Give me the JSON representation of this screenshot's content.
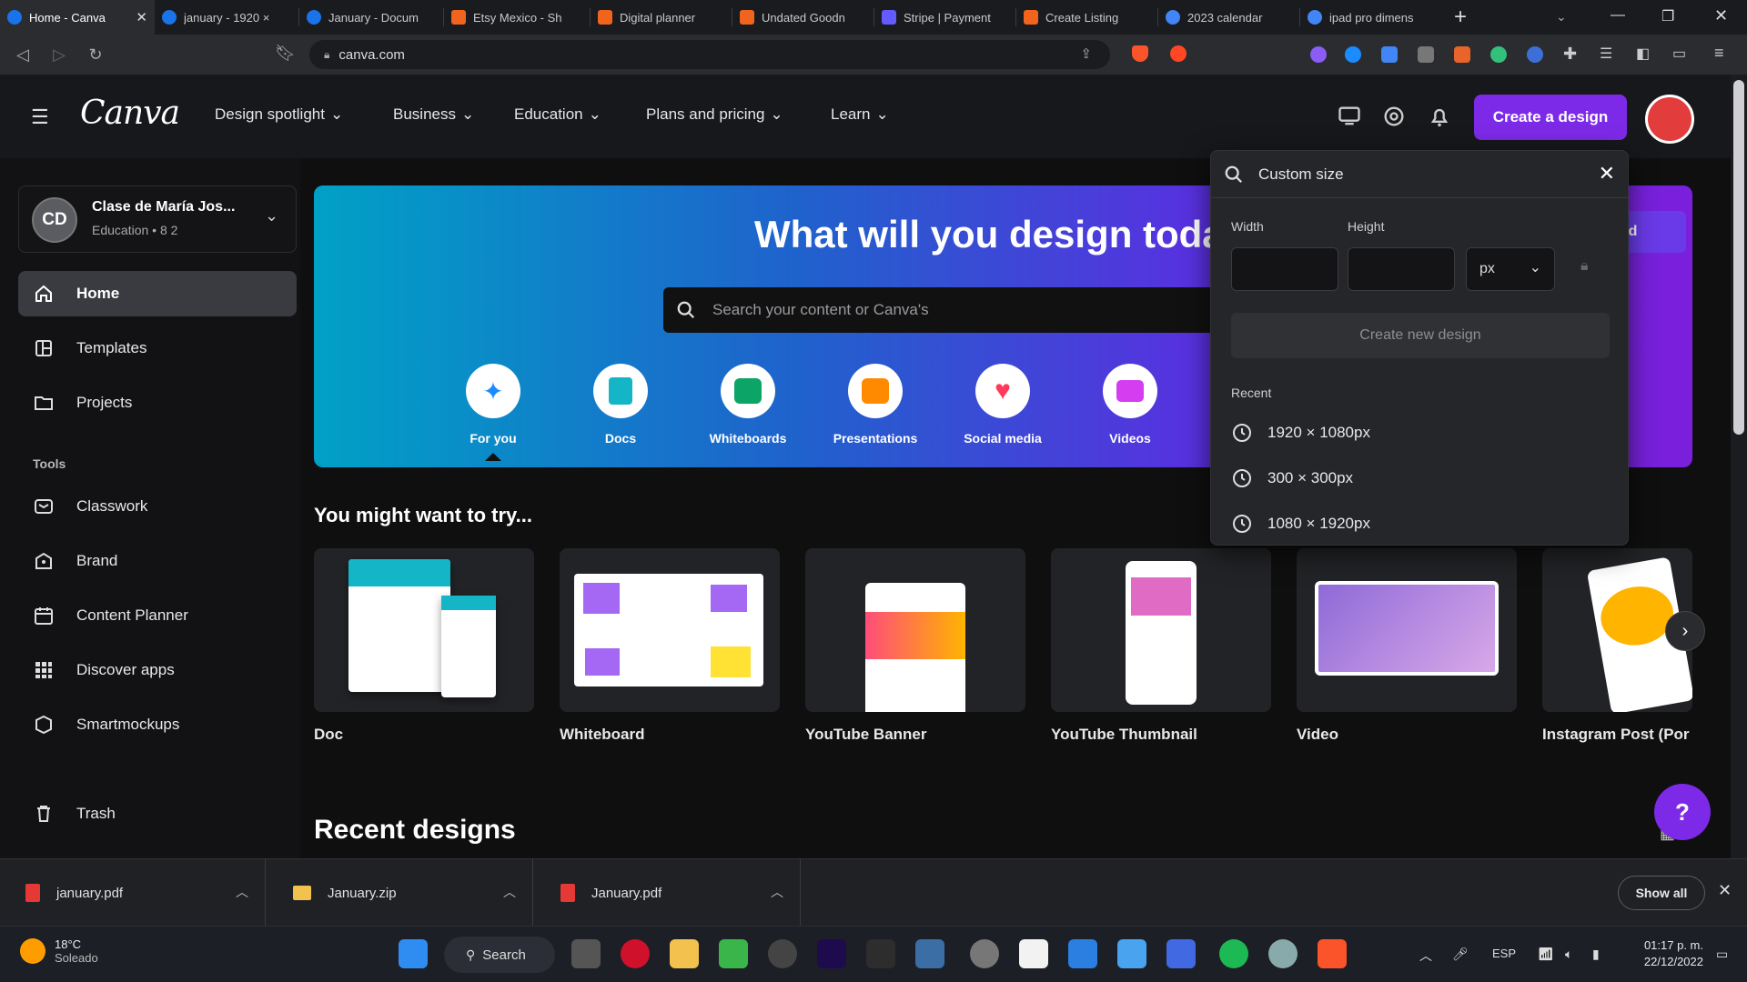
{
  "browser": {
    "tabs": [
      {
        "label": "Home - Canva",
        "color": "#1a73e8",
        "active": true
      },
      {
        "label": "january - 1920 ×",
        "color": "#1a73e8"
      },
      {
        "label": "January - Docum",
        "color": "#1a73e8"
      },
      {
        "label": "Etsy Mexico - Sh",
        "color": "#f1641e"
      },
      {
        "label": "Digital planner",
        "color": "#f1641e"
      },
      {
        "label": "Undated Goodn",
        "color": "#f1641e"
      },
      {
        "label": "Stripe | Payment",
        "color": "#635bff"
      },
      {
        "label": "Create Listing",
        "color": "#f1641e"
      },
      {
        "label": "2023 calendar",
        "color": "#4285f4"
      },
      {
        "label": "ipad pro dimens",
        "color": "#4285f4"
      }
    ],
    "new_tab": "+",
    "url": "canva.com"
  },
  "header": {
    "logo": "Canva",
    "nav": [
      "Design spotlight",
      "Business",
      "Education",
      "Plans and pricing",
      "Learn"
    ],
    "create_button": "Create a design"
  },
  "sidebar": {
    "team_initials": "CD",
    "team_name": "Clase de María Jos...",
    "team_sub": "Education • 8 2",
    "items": [
      {
        "label": "Home",
        "icon": "home-icon"
      },
      {
        "label": "Templates",
        "icon": "templates-icon"
      },
      {
        "label": "Projects",
        "icon": "folder-icon"
      }
    ],
    "tools_label": "Tools",
    "tools": [
      {
        "label": "Classwork",
        "icon": "classwork-icon"
      },
      {
        "label": "Brand",
        "icon": "brand-icon"
      },
      {
        "label": "Content Planner",
        "icon": "calendar-icon"
      },
      {
        "label": "Discover apps",
        "icon": "apps-icon"
      },
      {
        "label": "Smartmockups",
        "icon": "smartmockups-icon"
      }
    ],
    "trash": "Trash"
  },
  "hero": {
    "title": "What will you design toda",
    "search_placeholder": "Search your content or Canva's",
    "upload_label": "oad",
    "categories": [
      {
        "label": "For you",
        "color": "#1a8cff"
      },
      {
        "label": "Docs",
        "color": "#13b5c6"
      },
      {
        "label": "Whiteboards",
        "color": "#0ca567"
      },
      {
        "label": "Presentations",
        "color": "#ff8a00"
      },
      {
        "label": "Social media",
        "color": "#ff3b5c"
      },
      {
        "label": "Videos",
        "color": "#d53ef0"
      }
    ]
  },
  "try_section": {
    "title": "You might want to try...",
    "cards": [
      "Doc",
      "Whiteboard",
      "YouTube Banner",
      "YouTube Thumbnail",
      "Video",
      "Instagram Post (Por"
    ]
  },
  "recent_title": "Recent designs",
  "custom_size": {
    "search_value": "Custom size",
    "width_label": "Width",
    "height_label": "Height",
    "unit": "px",
    "create_button": "Create new design",
    "recent_label": "Recent",
    "recent": [
      "1920 × 1080px",
      "300 × 300px",
      "1080 × 1920px"
    ]
  },
  "downloads": {
    "files": [
      "january.pdf",
      "January.zip",
      "January.pdf"
    ],
    "show_all": "Show all"
  },
  "taskbar": {
    "temp": "18°C",
    "condition": "Soleado",
    "search": "Search",
    "lang": "ESP",
    "time": "01:17 p. m.",
    "date": "22/12/2022"
  },
  "help": "?"
}
